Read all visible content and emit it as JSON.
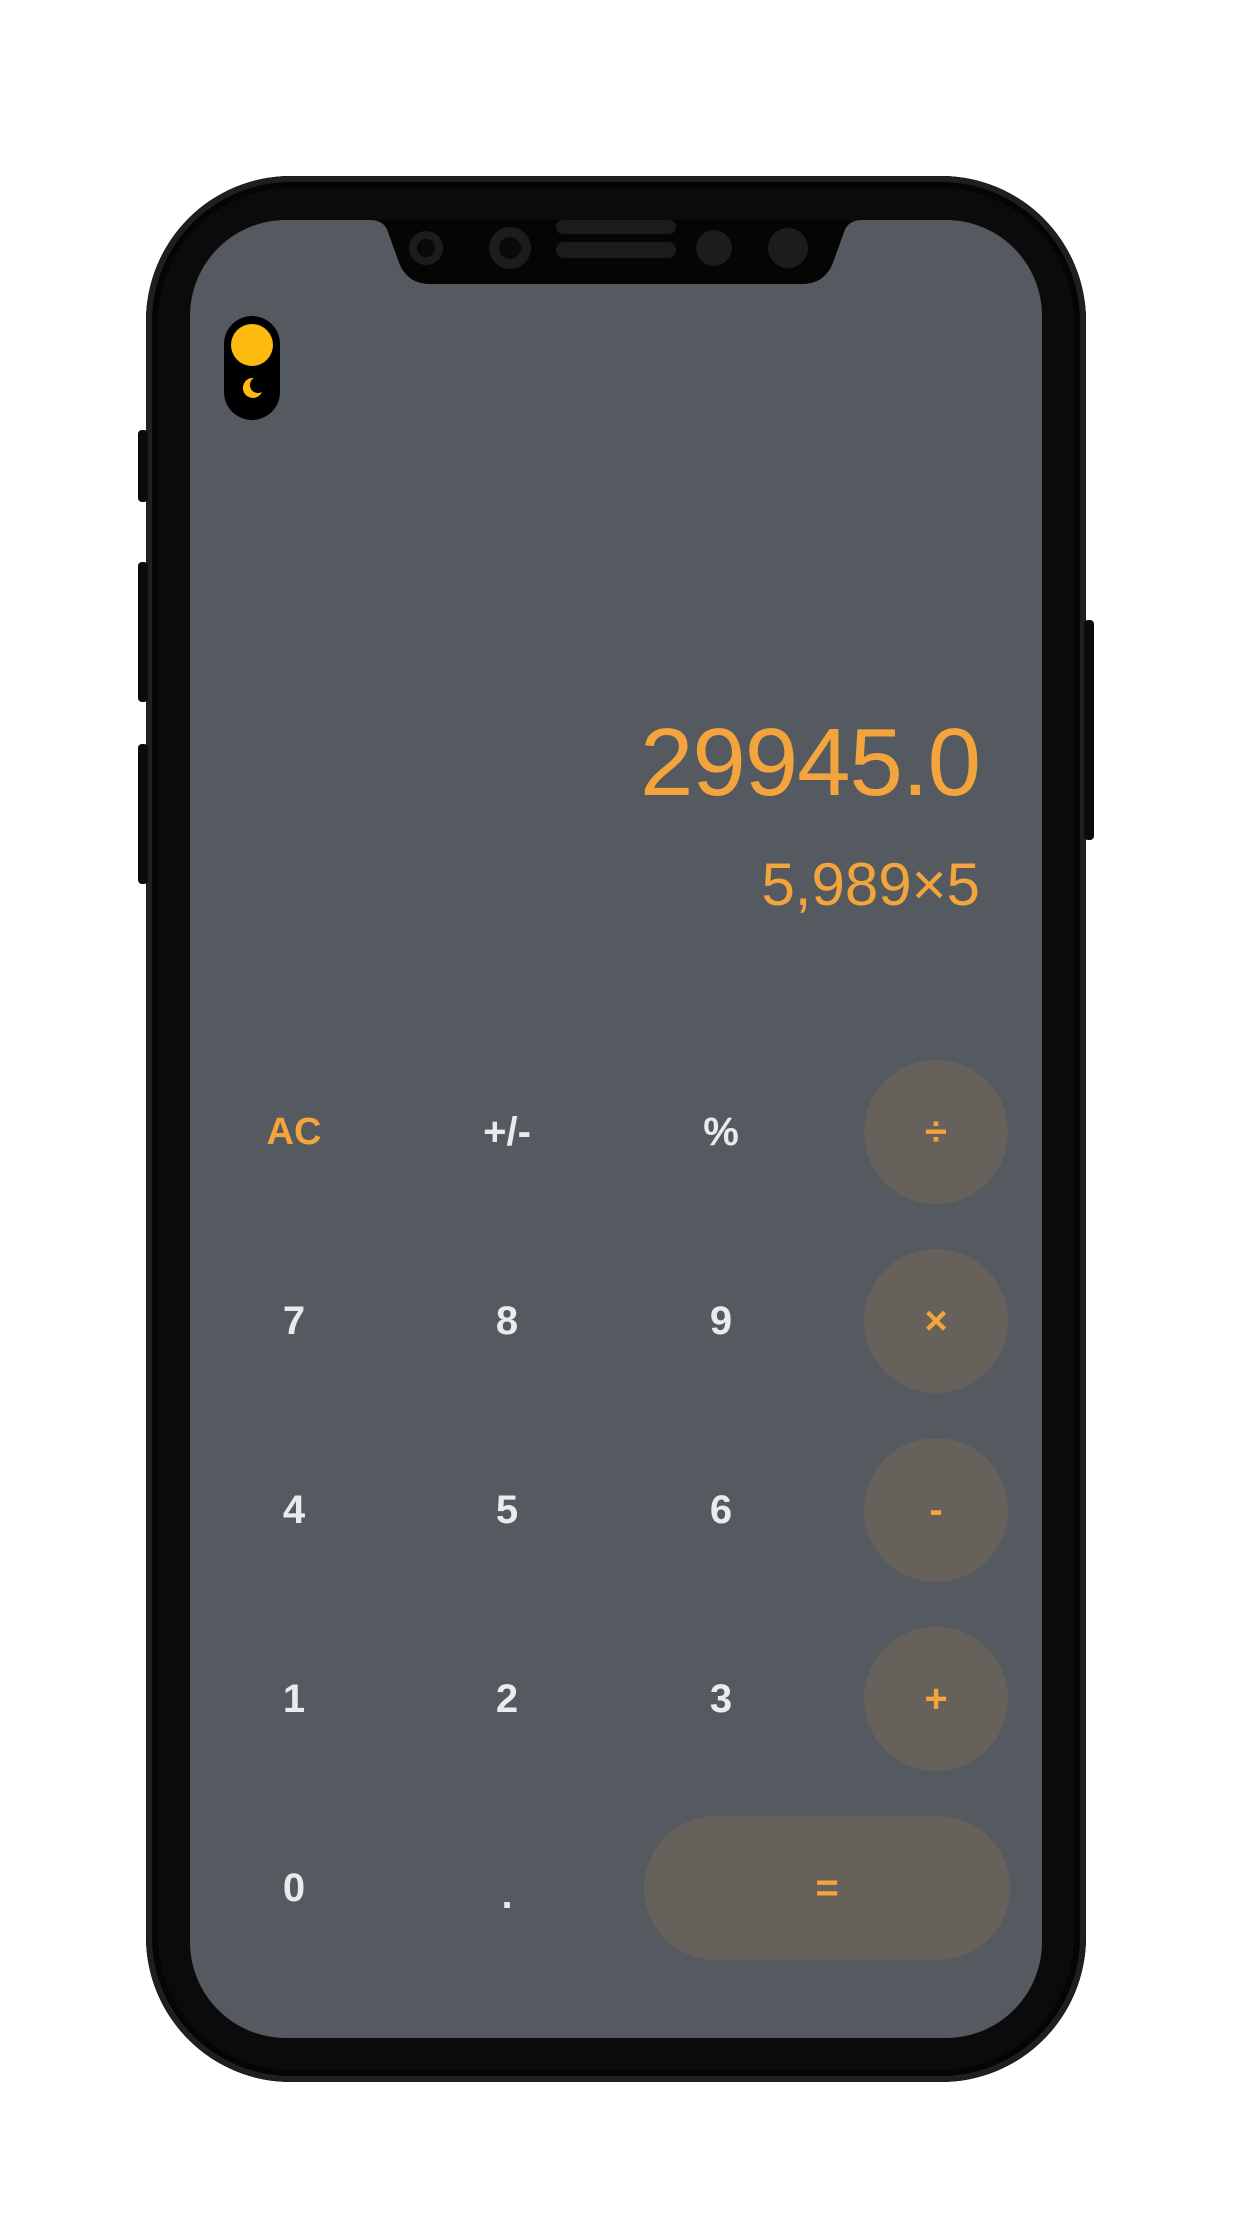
{
  "colors": {
    "screen_bg": "#555a60",
    "accent": "#f3a43c",
    "operator_bg": "#66625b",
    "digit_text": "#e9ecef",
    "toggle_knob": "#fdbb0f"
  },
  "theme_toggle": {
    "icon": "moon-icon",
    "state": "light"
  },
  "display": {
    "result": "29945.0",
    "expression": "5,989×5"
  },
  "keys": {
    "clear": "AC",
    "sign": "+/-",
    "percent": "%",
    "divide": "÷",
    "seven": "7",
    "eight": "8",
    "nine": "9",
    "multiply": "×",
    "four": "4",
    "five": "5",
    "six": "6",
    "subtract": "-",
    "one": "1",
    "two": "2",
    "three": "3",
    "add": "+",
    "zero": "0",
    "decimal": ".",
    "equals": "="
  }
}
